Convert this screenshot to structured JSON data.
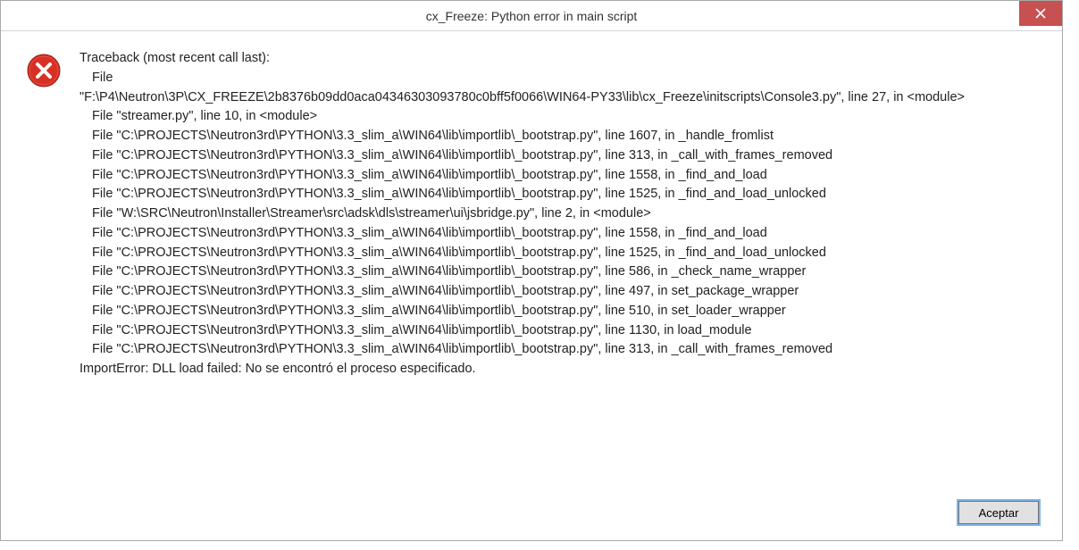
{
  "window": {
    "title": "cx_Freeze: Python error in main script"
  },
  "traceback": {
    "header": "Traceback (most recent call last):",
    "lines": [
      " File",
      "\"F:\\P4\\Neutron\\3P\\CX_FREEZE\\2b8376b09dd0aca04346303093780c0bff5f0066\\WIN64-PY33\\lib\\cx_Freeze\\initscripts\\Console3.py\", line 27, in <module>",
      " File \"streamer.py\", line 10, in <module>",
      " File \"C:\\PROJECTS\\Neutron3rd\\PYTHON\\3.3_slim_a\\WIN64\\lib\\importlib\\_bootstrap.py\", line 1607, in _handle_fromlist",
      " File \"C:\\PROJECTS\\Neutron3rd\\PYTHON\\3.3_slim_a\\WIN64\\lib\\importlib\\_bootstrap.py\", line 313, in _call_with_frames_removed",
      " File \"C:\\PROJECTS\\Neutron3rd\\PYTHON\\3.3_slim_a\\WIN64\\lib\\importlib\\_bootstrap.py\", line 1558, in _find_and_load",
      " File \"C:\\PROJECTS\\Neutron3rd\\PYTHON\\3.3_slim_a\\WIN64\\lib\\importlib\\_bootstrap.py\", line 1525, in _find_and_load_unlocked",
      " File \"W:\\SRC\\Neutron\\Installer\\Streamer\\src\\adsk\\dls\\streamer\\ui\\jsbridge.py\", line 2, in <module>",
      " File \"C:\\PROJECTS\\Neutron3rd\\PYTHON\\3.3_slim_a\\WIN64\\lib\\importlib\\_bootstrap.py\", line 1558, in _find_and_load",
      " File \"C:\\PROJECTS\\Neutron3rd\\PYTHON\\3.3_slim_a\\WIN64\\lib\\importlib\\_bootstrap.py\", line 1525, in _find_and_load_unlocked",
      " File \"C:\\PROJECTS\\Neutron3rd\\PYTHON\\3.3_slim_a\\WIN64\\lib\\importlib\\_bootstrap.py\", line 586, in _check_name_wrapper",
      " File \"C:\\PROJECTS\\Neutron3rd\\PYTHON\\3.3_slim_a\\WIN64\\lib\\importlib\\_bootstrap.py\", line 497, in set_package_wrapper",
      " File \"C:\\PROJECTS\\Neutron3rd\\PYTHON\\3.3_slim_a\\WIN64\\lib\\importlib\\_bootstrap.py\", line 510, in set_loader_wrapper",
      " File \"C:\\PROJECTS\\Neutron3rd\\PYTHON\\3.3_slim_a\\WIN64\\lib\\importlib\\_bootstrap.py\", line 1130, in load_module",
      " File \"C:\\PROJECTS\\Neutron3rd\\PYTHON\\3.3_slim_a\\WIN64\\lib\\importlib\\_bootstrap.py\", line 313, in _call_with_frames_removed"
    ],
    "error": "ImportError: DLL load failed: No se encontró el proceso especificado."
  },
  "buttons": {
    "accept": "Aceptar"
  }
}
